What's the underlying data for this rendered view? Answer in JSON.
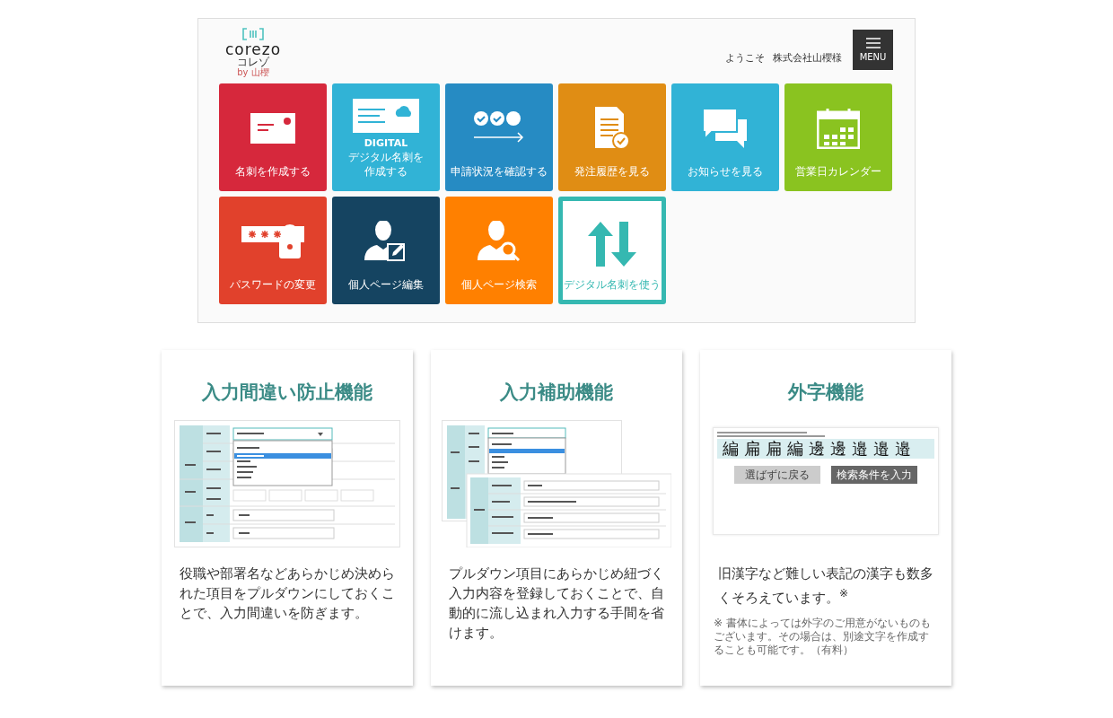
{
  "header": {
    "logo": {
      "wordmark": "corezo",
      "kana": "コレゾ",
      "maker": "by 山櫻"
    },
    "welcome": "ようこそ",
    "company": "株式会社山櫻様",
    "menu_button": "MENU"
  },
  "tiles": [
    {
      "kind": "card",
      "label": "名刺を作成する",
      "color": "#d6283c",
      "outlined": false
    },
    {
      "kind": "digital",
      "badge": "DIGITAL",
      "label": "デジタル名刺を作成する",
      "color": "#31b3d6",
      "outlined": false
    },
    {
      "kind": "progress",
      "label": "申請状況を確認する",
      "color": "#268bc3",
      "outlined": false
    },
    {
      "kind": "document",
      "label": "発注履歴を見る",
      "color": "#e08d14",
      "outlined": false
    },
    {
      "kind": "chat",
      "label": "お知らせを見る",
      "color": "#31b3d6",
      "outlined": false
    },
    {
      "kind": "calendar",
      "label": "営業日カレンダー",
      "color": "#8ac320",
      "outlined": false
    },
    {
      "kind": "password",
      "label": "パスワードの変更",
      "color": "#e1412c",
      "outlined": false
    },
    {
      "kind": "person-edit",
      "label": "個人ページ編集",
      "color": "#154461",
      "outlined": false
    },
    {
      "kind": "person-search",
      "label": "個人ページ検索",
      "color": "#ff8000",
      "outlined": false
    },
    {
      "kind": "transfer",
      "label": "デジタル名刺を使う",
      "color": "#35b8b1",
      "outlined": true
    }
  ],
  "features": [
    {
      "title": "入力間違い防止機能",
      "image": {
        "kind": "dropdown-form"
      },
      "description": "役職や部署名などあらかじめ決められた項目をプルダウンにしておくことで、入力間違いを防ぎます。"
    },
    {
      "title": "入力補助機能",
      "image": {
        "kind": "address-form"
      },
      "description": "プルダウン項目にあらかじめ紐づく入力内容を登録しておくことで、自動的に流し込まれ入力する手間を省けます。"
    },
    {
      "title": "外字機能",
      "image": {
        "kind": "glyph-picker",
        "glyphs": [
          "編",
          "扁",
          "扁",
          "編",
          "邊",
          "邊",
          "邉",
          "邉",
          "邉"
        ],
        "buttons": [
          "選ばずに戻る",
          "検索条件を入力"
        ]
      },
      "description": "旧漢字など難しい表記の漢字も数多くそろえています。$^{※}$",
      "note": "※ 書体によっては外字のご用意がないものもございます。その場合は、別途文字を作成することも可能です。（有料）"
    }
  ]
}
